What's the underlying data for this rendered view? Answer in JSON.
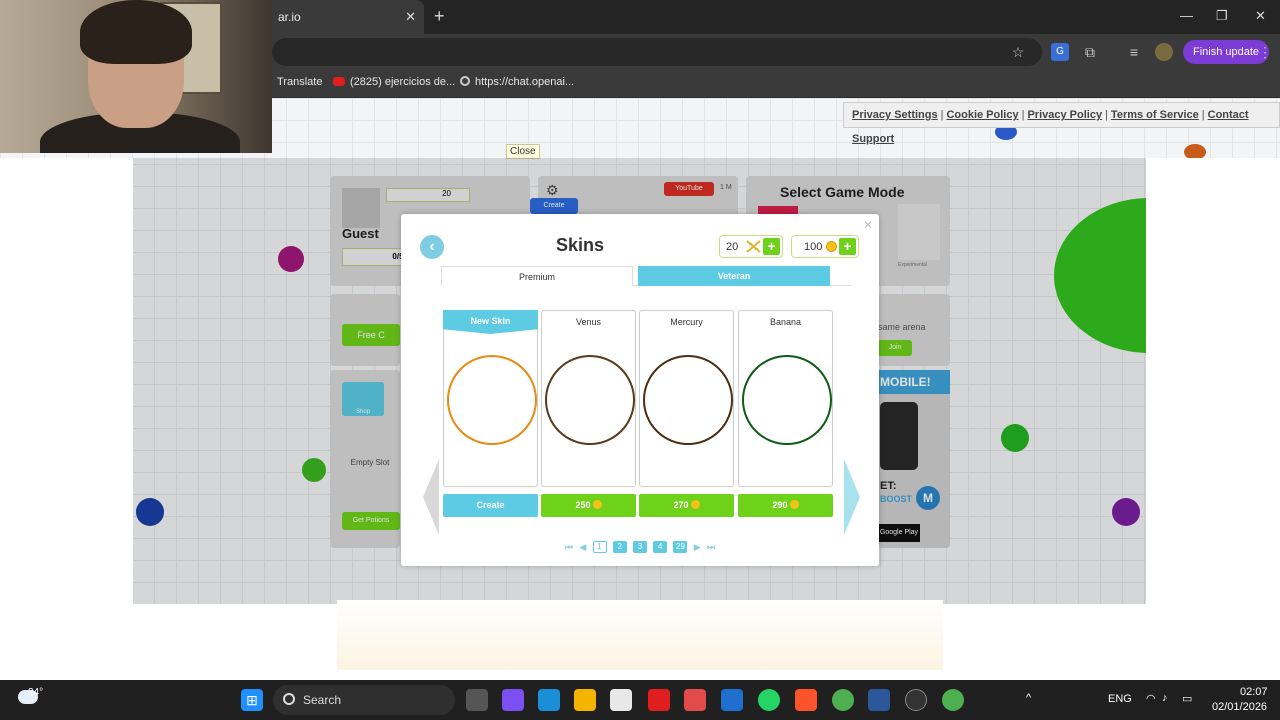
{
  "browser": {
    "tab_title": "ar.io",
    "tab_close": "✕",
    "new_tab": "+",
    "finish_update": "Finish update",
    "bookmarks": [
      "Translate",
      "(2825) ejercicios de...",
      "https://chat.openai..."
    ],
    "window_controls": [
      "—",
      "❐",
      "✕"
    ]
  },
  "page": {
    "policy_links": [
      "Privacy Settings",
      "Cookie Policy",
      "Privacy Policy",
      "Terms of Service",
      "Contact Support"
    ],
    "close_label": "Close",
    "background": {
      "guest_label": "Guest",
      "guest_dna": "20",
      "guest_progress": "0/50",
      "youtube_label": "YouTube",
      "youtube_count": "1 M",
      "create_label": "Create",
      "select_game_mode": "Select Game Mode",
      "experimental_label": "Experimental",
      "free_coins": "Free C",
      "shop_label": "Shop",
      "empty_slot": "Empty Slot",
      "get_potions": "Get Potions",
      "same_arena": "same arena",
      "join_label": "Join",
      "mobile_banner": "MOBILE!",
      "get_label": "ET:",
      "boost_label": "BOOST",
      "google_play": "Google Play",
      "badge_letter": "M"
    }
  },
  "skins_modal": {
    "title": "Skins",
    "back_icon": "‹",
    "close_icon": "✕",
    "dna_value": "20",
    "coins_value": "100",
    "plus": "+",
    "tabs": [
      "Premium",
      "Veteran"
    ],
    "skins": [
      {
        "name": "New Skin",
        "color": "#e88a14",
        "button": "Create",
        "price": null
      },
      {
        "name": "Venus",
        "color": "#5a3a1a",
        "button": "250",
        "price": "250"
      },
      {
        "name": "Mercury",
        "color": "#4a2f14",
        "button": "270",
        "price": "270"
      },
      {
        "name": "Banana",
        "color": "#0f5a14",
        "button": "290",
        "price": "290"
      }
    ],
    "pager": {
      "first": "⏮",
      "prev": "◀",
      "pages": [
        "1",
        "2",
        "3",
        "4",
        "29"
      ],
      "next": "▶",
      "last": "⏭",
      "active_page": "1"
    }
  },
  "taskbar": {
    "temperature": "24°",
    "search_placeholder": "Search",
    "language": "ENG",
    "time": "02:07",
    "date": "02/01/2026"
  },
  "colors": {
    "accent": "#5ccbe3",
    "buy_green": "#6ed11a",
    "coin_gold": "#f7c11b"
  }
}
